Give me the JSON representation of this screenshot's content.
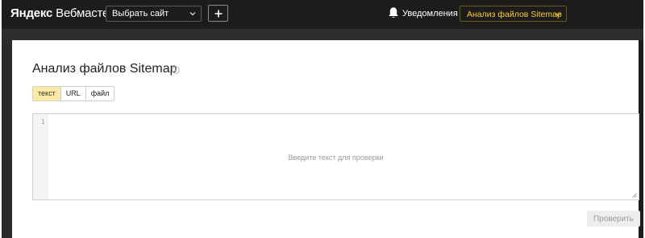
{
  "header": {
    "logo_part1": "Яндекс",
    "logo_part2": "Вебмастер",
    "site_select": {
      "value": "Выбрать сайт",
      "icon": "chevron-down-icon"
    },
    "add_button": {
      "icon": "plus-icon"
    },
    "notifications": {
      "label": "Уведомления",
      "icon": "bell-icon"
    },
    "tool_select": {
      "value": "Анализ файлов Sitemap",
      "icon": "chevron-down-icon",
      "color": "#ffcc33"
    }
  },
  "main": {
    "title": "Анализ файлов Sitemap",
    "title_icon": "info-icon",
    "tabs": [
      {
        "label": "текст",
        "active": true
      },
      {
        "label": "URL",
        "active": false
      },
      {
        "label": "файл",
        "active": false
      }
    ],
    "editor": {
      "line_number": "1",
      "placeholder": "Введите текст для проверки"
    },
    "submit_label": "Проверить"
  },
  "colors": {
    "header_bg": "#1c1c1c",
    "accent": "#ffcc33",
    "active_tab_bg": "#fde9a6"
  }
}
